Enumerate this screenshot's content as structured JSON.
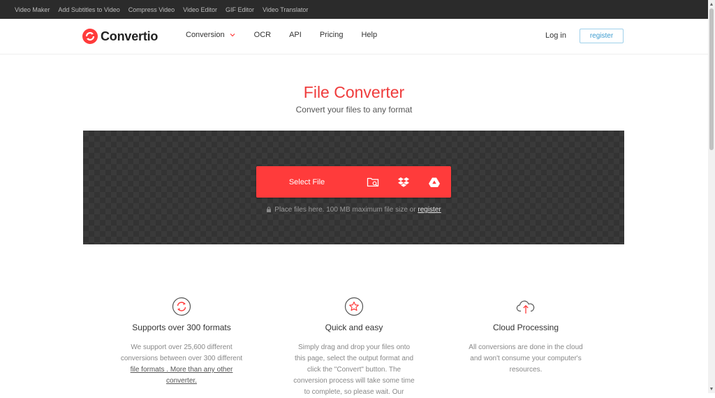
{
  "topbar": {
    "links": [
      "Video Maker",
      "Add Subtitles to Video",
      "Compress Video",
      "Video Editor",
      "GIF Editor",
      "Video Translator"
    ]
  },
  "header": {
    "logo_text": "Convertio",
    "nav": [
      "Conversion",
      "OCR",
      "API",
      "Pricing",
      "Help"
    ],
    "login": "Log in",
    "register": "register"
  },
  "hero": {
    "title": "File Converter",
    "subtitle": "Convert your files to any format"
  },
  "upload": {
    "select_label": "Select File",
    "hint_text": "Place files here. 100 MB maximum file size or",
    "hint_link": "register"
  },
  "features": [
    {
      "title": "Supports over 300 formats",
      "text_a": "We support over 25,600 different conversions between over 300 different",
      "link": "file formats . More than any other converter."
    },
    {
      "title": "Quick and easy",
      "text_a": "Simply drag and drop your files onto this page, select the output format and click the \"Convert\" button. The conversion process will take some time to complete, so please wait. Our"
    },
    {
      "title": "Cloud Processing",
      "text_a": "All conversions are done in the cloud and won't consume your computer's resources."
    }
  ],
  "colors": {
    "brand_red": "#ff3b3b",
    "title_red": "#ef3b3b",
    "register_blue": "#3b9bd0"
  }
}
